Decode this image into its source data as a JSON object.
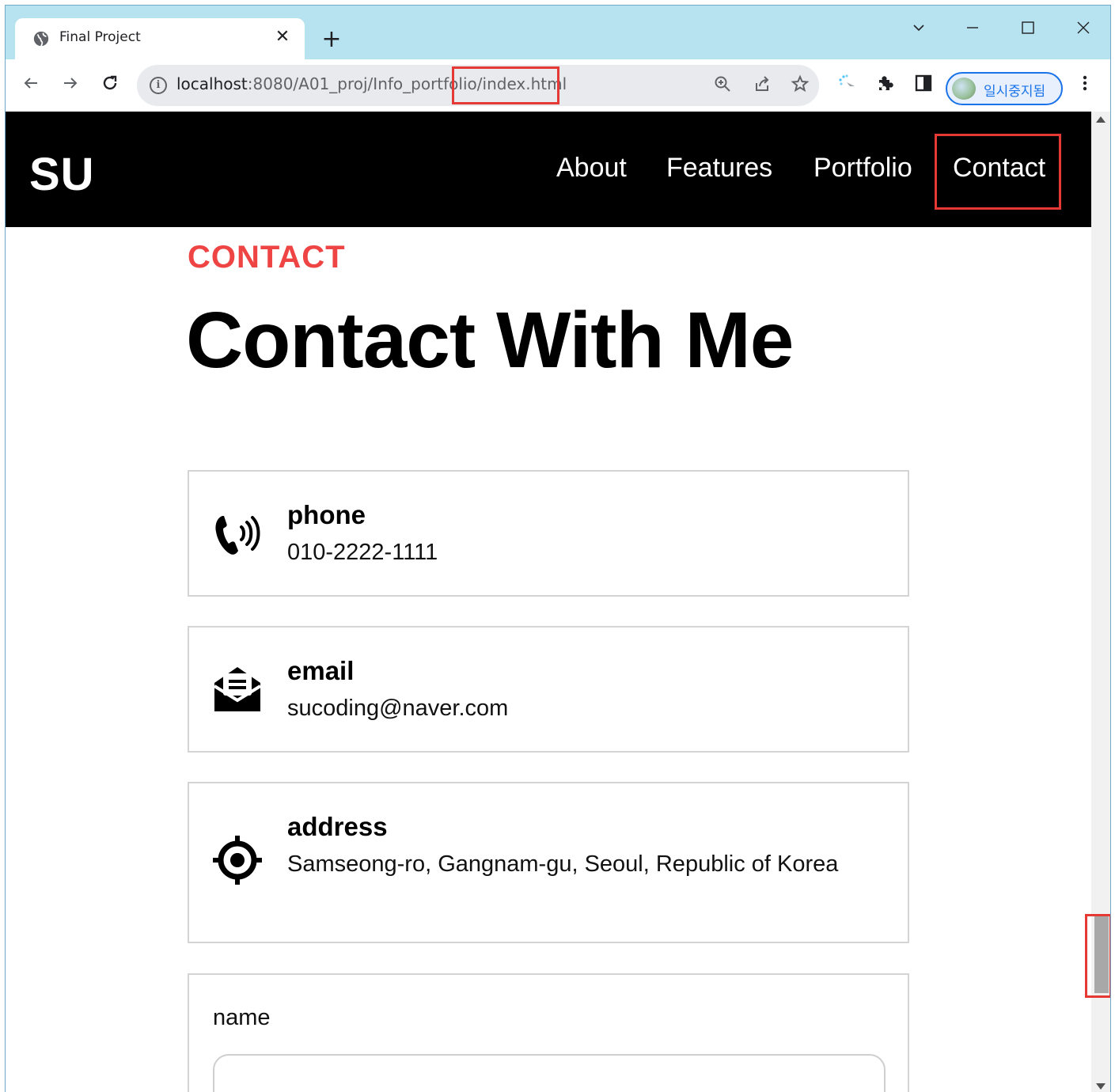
{
  "browser": {
    "tab_title": "Final Project",
    "tab_close": "✕",
    "new_tab": "+",
    "url_host": "localhost",
    "url_path": ":8080/A01_proj/Info_portfolio/index.html",
    "profile_label": "일시중지됨",
    "window_controls": {
      "dropdown": "⌵",
      "minimize": "—",
      "maximize": "☐",
      "close": "✕"
    },
    "icons": [
      "back-icon",
      "forward-icon",
      "reload-icon",
      "info-icon",
      "zoom-icon",
      "share-icon",
      "bookmark-star-icon",
      "extension-loading-icon",
      "extensions-puzzle-icon",
      "side-panel-icon",
      "menu-kebab-icon"
    ]
  },
  "site": {
    "logo": "SU",
    "nav": [
      {
        "label": "About"
      },
      {
        "label": "Features"
      },
      {
        "label": "Portfolio"
      },
      {
        "label": "Contact"
      }
    ]
  },
  "section": {
    "eyebrow": "CONTACT",
    "title": "Contact With Me"
  },
  "contacts": [
    {
      "label": "phone",
      "value": "010-2222-1111",
      "icon": "phone-icon"
    },
    {
      "label": "email",
      "value": "sucoding@naver.com",
      "icon": "envelope-icon"
    },
    {
      "label": "address",
      "value": "Samseong-ro, Gangnam-gu, Seoul, Republic of Korea",
      "icon": "location-icon"
    }
  ],
  "form": {
    "name_label": "name",
    "name_value": ""
  },
  "colors": {
    "accent": "#ef4444",
    "highlight": "#e53935",
    "header_bg": "#000000",
    "tabstrip_bg": "#b7e3f0"
  }
}
